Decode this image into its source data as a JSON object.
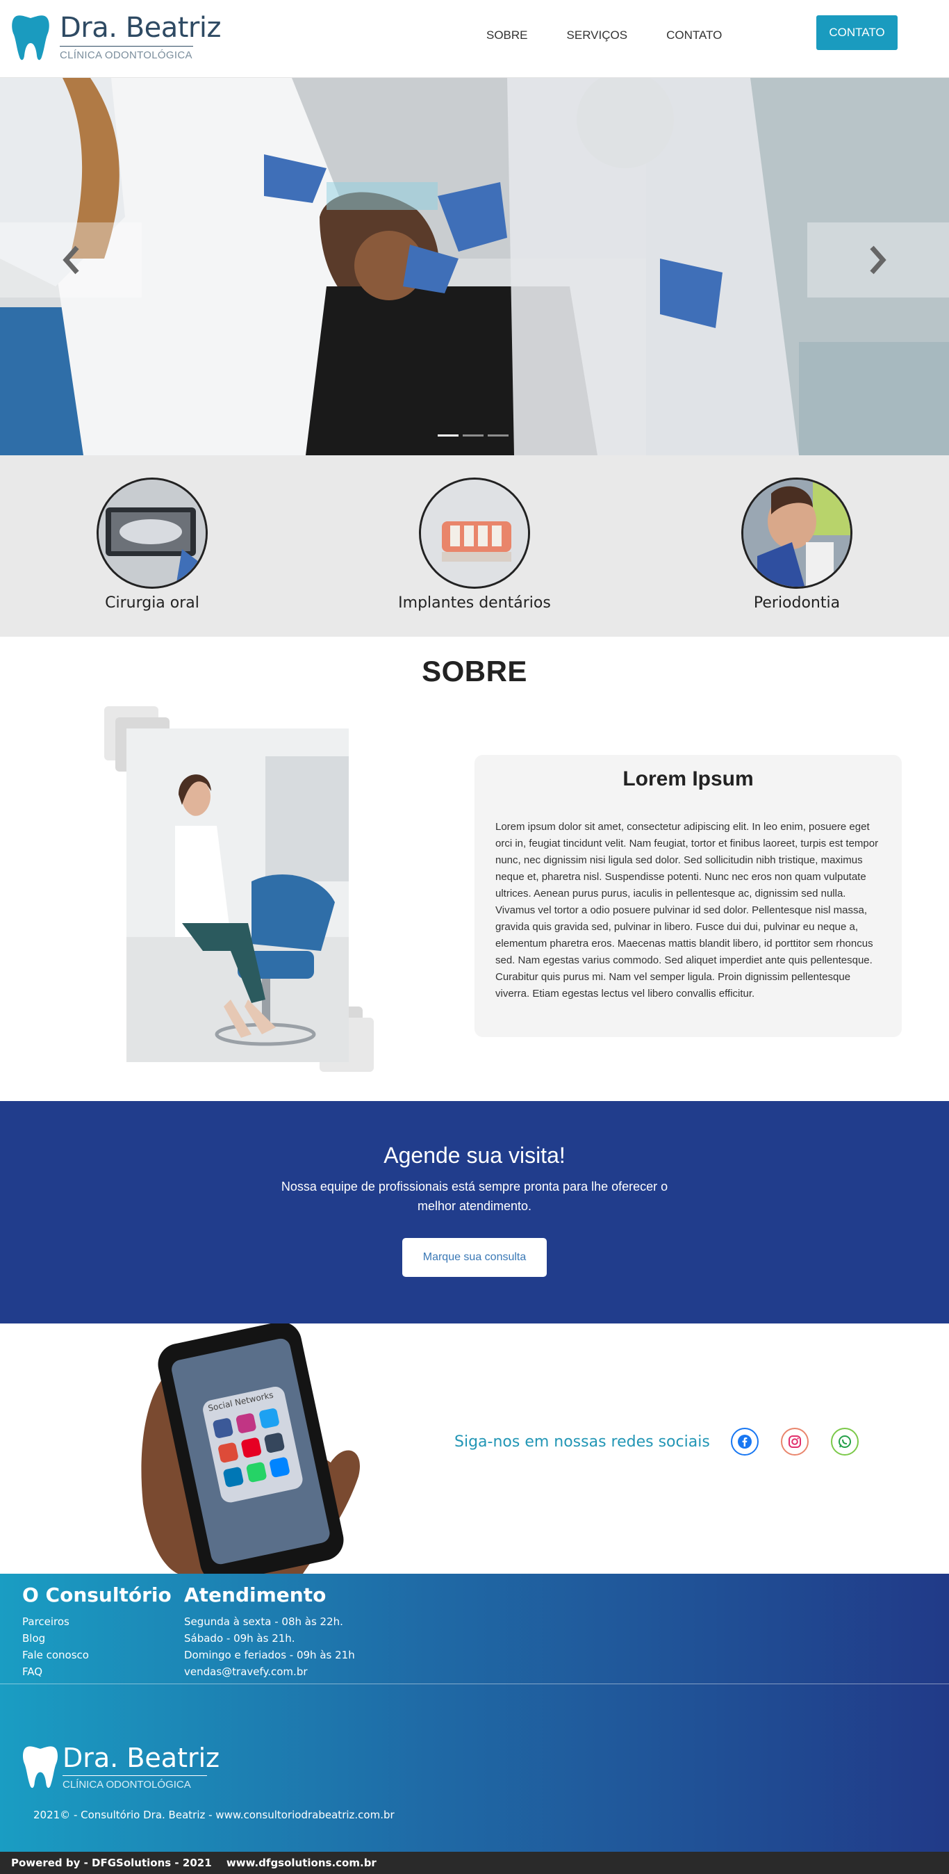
{
  "brand": {
    "name": "Dra. Beatriz",
    "subtitle": "CLÍNICA ODONTOLÓGICA"
  },
  "nav": {
    "items": [
      "SOBRE",
      "SERVIÇOS",
      "CONTATO"
    ],
    "cta": "CONTATO"
  },
  "hero": {
    "slides": 3,
    "active_slide": 1
  },
  "services": [
    {
      "label": "Cirurgia oral"
    },
    {
      "label": "Implantes dentários"
    },
    {
      "label": "Periodontia"
    }
  ],
  "sobre": {
    "title": "SOBRE",
    "card_title": "Lorem Ipsum",
    "card_text": "Lorem ipsum dolor sit amet, consectetur adipiscing elit. In leo enim, posuere eget orci in, feugiat tincidunt velit. Nam feugiat, tortor et finibus laoreet, turpis est tempor nunc, nec dignissim nisi ligula sed dolor. Sed sollicitudin nibh tristique, maximus neque et, pharetra nisl. Suspendisse potenti. Nunc nec eros non quam vulputate ultrices. Aenean purus purus, iaculis in pellentesque ac, dignissim sed nulla. Vivamus vel tortor a odio posuere pulvinar id sed dolor. Pellentesque nisl massa, gravida quis gravida sed, pulvinar in libero. Fusce dui dui, pulvinar eu neque a, elementum pharetra eros. Maecenas mattis blandit libero, id porttitor sem rhoncus sed. Nam egestas varius commodo. Sed aliquet imperdiet ante quis pellentesque. Curabitur quis purus mi. Nam vel semper ligula. Proin dignissim pellentesque viverra. Etiam egestas lectus vel libero convallis efficitur."
  },
  "agende": {
    "title": "Agende sua visita!",
    "text": "Nossa equipe de profissionais está sempre pronta para lhe oferecer o melhor atendimento.",
    "button": "Marque sua consulta"
  },
  "social": {
    "text": "Siga-nos em nossas redes sociais",
    "phone_label": "Social Networks",
    "icons": [
      "facebook",
      "instagram",
      "whatsapp"
    ],
    "colors": {
      "facebook": "#1877f2",
      "instagram": "#e1306c",
      "whatsapp": "#25d366"
    }
  },
  "footer": {
    "col1": {
      "title": "O Consultório",
      "items": [
        "Parceiros",
        "Blog",
        "Fale conosco",
        "FAQ"
      ]
    },
    "col2": {
      "title": "Atendimento",
      "items": [
        "Segunda à sexta - 08h às 22h.",
        "Sábado - 09h às 21h.",
        "Domingo e feriados - 09h às 21h",
        "vendas@travefy.com.br"
      ]
    },
    "copyright": "2021© - Consultório Dra. Beatriz - www.consultoriodrabeatriz.com.br"
  },
  "powered": {
    "text": "Powered by - DFGSolutions - 2021",
    "url": "www.dfgsolutions.com.br"
  },
  "colors": {
    "accent": "#1a9bbf",
    "navy": "#213d8c",
    "text": "#222222"
  }
}
